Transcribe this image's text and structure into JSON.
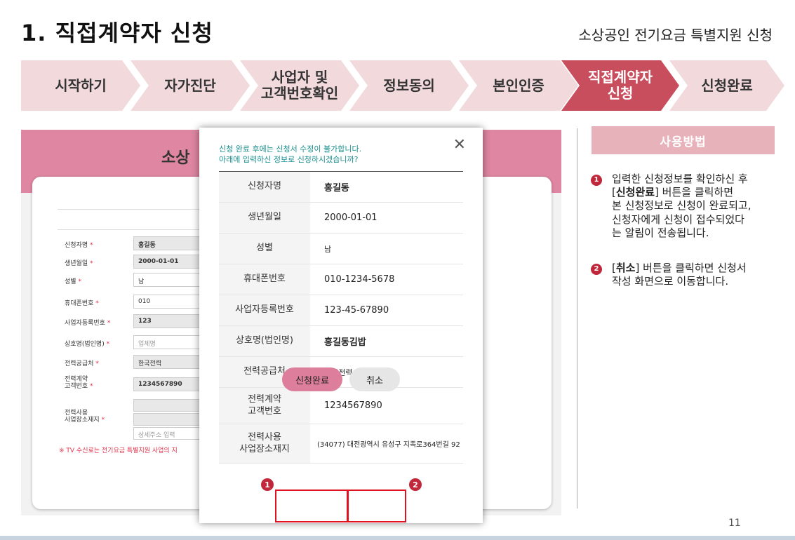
{
  "page": {
    "title": "1. 직접계약자 신청",
    "subtitle": "소상공인 전기요금 특별지원 신청",
    "page_number": "11"
  },
  "steps": [
    {
      "label": "시작하기",
      "active": false
    },
    {
      "label": "자가진단",
      "active": false
    },
    {
      "label": "사업자 및\n고객번호확인",
      "active": false
    },
    {
      "label": "정보동의",
      "active": false
    },
    {
      "label": "본인인증",
      "active": false
    },
    {
      "label": "직접계약자\n신청",
      "active": true
    },
    {
      "label": "신청완료",
      "active": false
    }
  ],
  "background_form": {
    "title_partial": "소상",
    "rows": [
      {
        "label": "신청자명",
        "value": "홍길동"
      },
      {
        "label": "생년월일",
        "value": "2000-01-01"
      },
      {
        "label": "성별",
        "value": "남"
      },
      {
        "label": "휴대폰번호",
        "value": "010"
      },
      {
        "label": "사업자등록번호",
        "value": "123"
      },
      {
        "label": "상호명(법인명)",
        "value": "업체명"
      },
      {
        "label": "전력공급처",
        "value": "한국전력"
      },
      {
        "label": "전력계약\n고객번호",
        "value": "1234567890"
      },
      {
        "label": "전력사용\n사업장소재지",
        "value": "상세주소 입력"
      }
    ],
    "required_mark": "*",
    "note": "※ TV 수신료는 전기요금 특별지원 사업의 지"
  },
  "modal": {
    "message_line1": "신청 완료 후에는 신청서 수정이 불가합니다.",
    "message_line2": "아래에 입력하신 정보로 신청하시겠습니까?",
    "close_glyph": "✕",
    "rows": [
      {
        "label": "신청자명",
        "value": "홍길동"
      },
      {
        "label": "생년월일",
        "value": "2000-01-01"
      },
      {
        "label": "성별",
        "value": "남"
      },
      {
        "label": "휴대폰번호",
        "value": "010-1234-5678"
      },
      {
        "label": "사업자등록번호",
        "value": "123-45-67890"
      },
      {
        "label": "상호명(법인명)",
        "value": "홍길동김밥"
      },
      {
        "label": "전력공급처",
        "value": "한국전력"
      },
      {
        "label": "전력계약\n고객번호",
        "value": "1234567890"
      },
      {
        "label": "전력사용\n사업장소재지",
        "value": "(34077) 대전광역시 유성구 지족로364번길 92"
      }
    ],
    "confirm_label": "신청완료",
    "cancel_label": "취소",
    "marker1": "1",
    "marker2": "2"
  },
  "howto": {
    "title": "사용방법",
    "items": [
      {
        "num": "1",
        "pre": "입력한 신청정보를 확인하신 후\n[",
        "bold": "신청완료",
        "post": "] 버튼을 클릭하면\n본 신청정보로 신청이 완료되고,\n신청자에게 신청이 접수되었다\n는 알림이 전송됩니다."
      },
      {
        "num": "2",
        "pre": "[",
        "bold": "취소",
        "post": "] 버튼을 클릭하면 신청서\n작성 화면으로 이동합니다."
      }
    ]
  },
  "colors": {
    "step_bg": "#f1d9dc",
    "step_active": "#c94e5d",
    "highlight": "#e1121f",
    "modal_message": "#1a8f8f",
    "confirm_button": "#dd7e9c"
  }
}
